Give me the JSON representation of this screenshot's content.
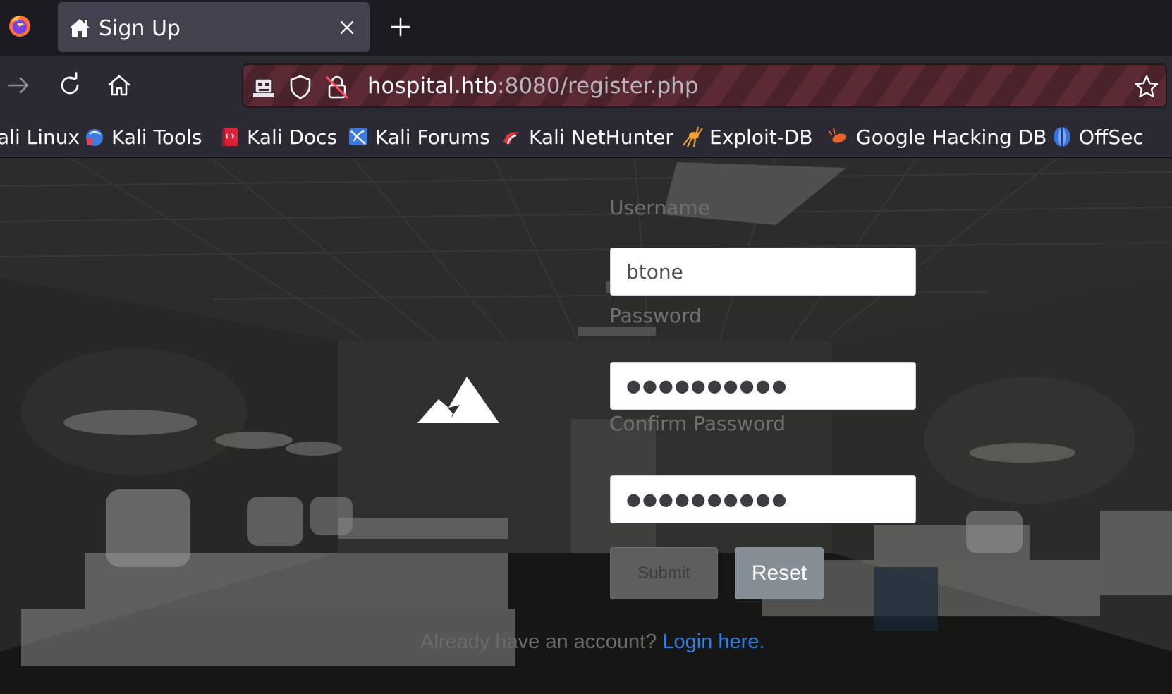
{
  "browser": {
    "tab": {
      "title": "Sign Up"
    },
    "url": {
      "host": "hospital.htb",
      "rest": ":8080/register.php"
    }
  },
  "bookmarks": [
    {
      "label": "ali Linux",
      "icon": "kali-linux-icon"
    },
    {
      "label": "Kali Tools",
      "icon": "kali-tools-icon"
    },
    {
      "label": "Kali Docs",
      "icon": "kali-docs-icon"
    },
    {
      "label": "Kali Forums",
      "icon": "kali-forums-icon"
    },
    {
      "label": "Kali NetHunter",
      "icon": "kali-nethunter-icon"
    },
    {
      "label": "Exploit-DB",
      "icon": "exploit-db-icon"
    },
    {
      "label": "Google Hacking DB",
      "icon": "google-hacking-db-icon"
    },
    {
      "label": "OffSec",
      "icon": "offsec-icon"
    }
  ],
  "form": {
    "username_label": "Username",
    "username_value": "btone",
    "password_label": "Password",
    "password_value": "●●●●●●●●●●",
    "confirm_label": "Confirm Password",
    "confirm_value": "●●●●●●●●●●",
    "submit_label": "Submit",
    "reset_label": "Reset",
    "login_prompt": "Already have an account?",
    "login_link": "Login here",
    "login_suffix": "."
  },
  "colors": {
    "link": "#2f7fe8",
    "reset_button": "#868e96",
    "url_stripe_a": "#5b2a33",
    "url_stripe_b": "#4a2229"
  }
}
